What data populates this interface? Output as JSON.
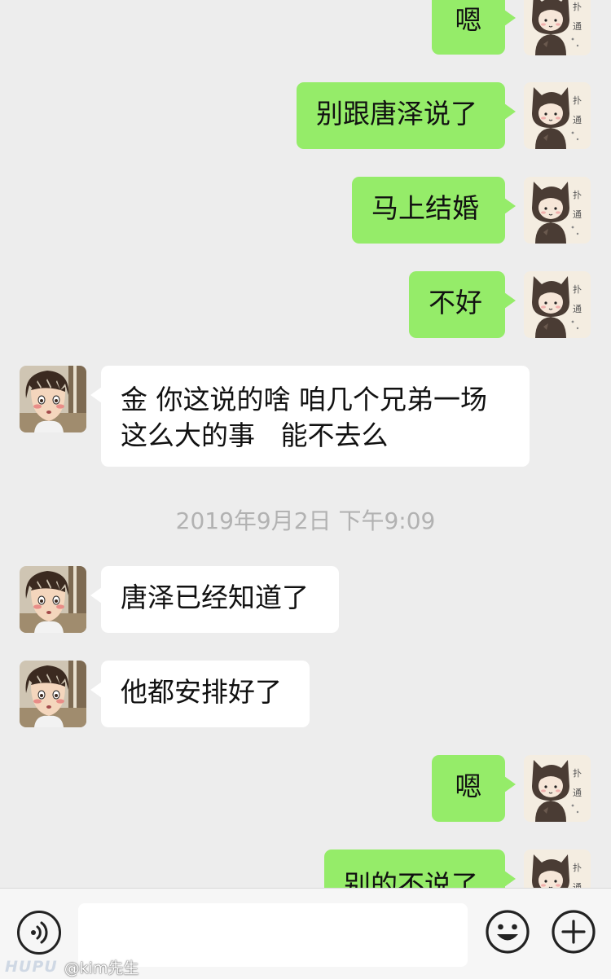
{
  "messages": [
    {
      "side": "sent",
      "text": "嗯"
    },
    {
      "side": "sent",
      "text": "别跟唐泽说了"
    },
    {
      "side": "sent",
      "text": "马上结婚"
    },
    {
      "side": "sent",
      "text": "不好"
    },
    {
      "side": "recv",
      "lines": [
        "金 你这说的啥 咱几个兄弟一场",
        "这么大的事   能不去么"
      ]
    },
    {
      "side": "recv",
      "text": "唐泽已经知道了"
    },
    {
      "side": "recv",
      "text": "他都安排好了"
    },
    {
      "side": "sent",
      "text": "嗯"
    },
    {
      "side": "sent",
      "text": "别的不说了"
    }
  ],
  "timestamp": "2019年9月2日 下午9:09",
  "self_avatar_text": [
    "扑",
    "通"
  ],
  "colors": {
    "sent_bubble": "#95ec69",
    "recv_bubble": "#ffffff",
    "background": "#ededed"
  },
  "input_bar": {
    "voice_icon": "voice-icon",
    "emoji_icon": "emoji-icon",
    "plus_icon": "plus-icon",
    "input_value": ""
  },
  "watermark": {
    "logo": "HUPU",
    "user": "@kim先生"
  }
}
